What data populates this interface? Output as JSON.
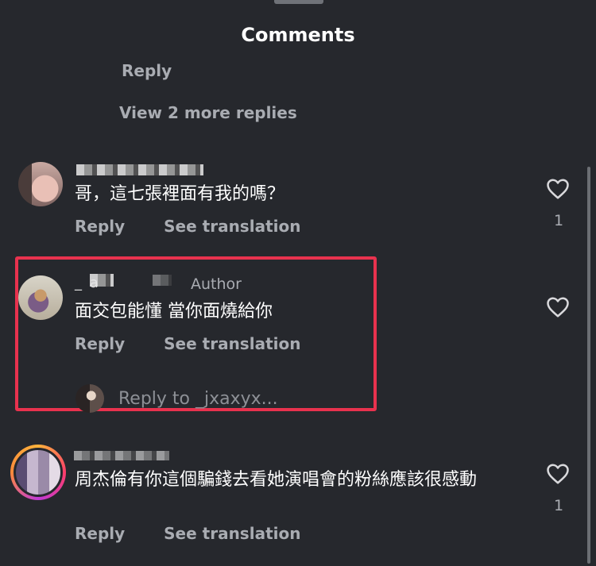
{
  "header": {
    "title": "Comments"
  },
  "top_thread": {
    "reply_label": "Reply",
    "view_more_label": "View 2 more replies"
  },
  "comments": [
    {
      "username_partial": "",
      "text": "哥，這七張裡面有我的嗎？",
      "reply_label": "Reply",
      "translate_label": "See translation",
      "likes": "1",
      "heart_icon": "heart-outline-icon"
    },
    {
      "username_partial": "_ a",
      "badge": "Author",
      "text": "面交包能懂 當你面燒給你",
      "reply_label": "Reply",
      "translate_label": "See translation",
      "heart_icon": "heart-outline-icon",
      "reply_placeholder": "Reply to _jxaxyx..."
    },
    {
      "username_partial": "",
      "text": "周杰倫有你這個騙錢去看她演唱會的粉絲應該很感動",
      "reply_label": "Reply",
      "translate_label": "See translation",
      "likes": "1",
      "heart_icon": "heart-outline-icon"
    }
  ],
  "colors": {
    "background": "#26282d",
    "secondary_text": "#a9acb2",
    "highlight_border": "#e8324e"
  }
}
